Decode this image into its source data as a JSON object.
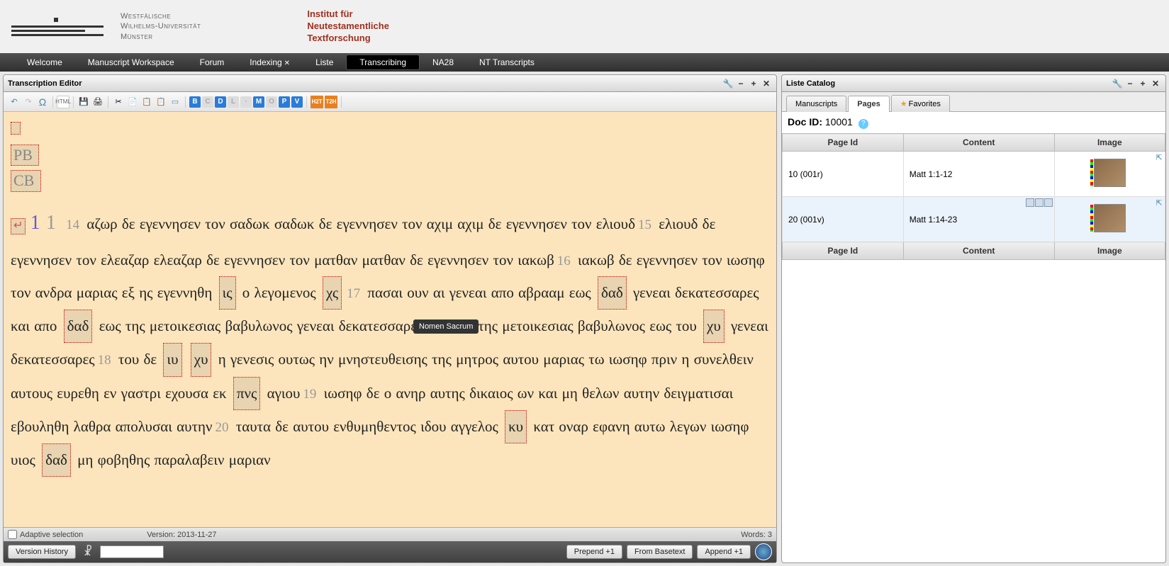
{
  "header": {
    "uni_line1": "Westfälische",
    "uni_line2": "Wilhelms-Universität",
    "uni_line3": "Münster",
    "inst_line1": "Institut für",
    "inst_line2": "Neutestamentliche",
    "inst_line3": "Textforschung"
  },
  "nav": {
    "welcome": "Welcome",
    "workspace": "Manuscript Workspace",
    "forum": "Forum",
    "indexing": "Indexing",
    "liste": "Liste",
    "transcribing": "Transcribing",
    "na28": "NA28",
    "nttranscripts": "NT Transcripts"
  },
  "left_panel": {
    "title": "Transcription Editor",
    "toolbar": {
      "undo": "↶",
      "redo": "↷",
      "omega": "Ω",
      "html": "HTML",
      "save": "💾",
      "print": "🖨",
      "cut": "✂",
      "copy": "📄",
      "paste": "📋",
      "paste2": "📋",
      "window": "▭",
      "B": "B",
      "C": "C",
      "D": "D",
      "L": "L",
      "M": "M",
      "O": "O",
      "P": "P",
      "V": "V",
      "h2t": "H2T",
      "t2h": "T2H"
    },
    "top_marker": "",
    "pb": "PB",
    "cb": "CB",
    "chapter": "1",
    "verse_big": "1",
    "verses": {
      "v14": "14",
      "v15": "15",
      "v16": "16",
      "v17": "17",
      "v18": "18",
      "v19": "19",
      "v20": "20"
    },
    "text": {
      "t14a": " αζωρ δε εγεννησεν τον σαδωκ σαδωκ δε εγεννησεν τον αχιμ αχιμ δε εγεννησεν τον ελιουδ",
      "t15a": " ελιουδ δε εγεννησεν τον ελεαζαρ ελεαζαρ δε εγεννησεν τον ματθαν ματθαν δε εγεννησεν τον ιακωβ",
      "t16a": " ιακωβ δε εγεννησεν τον ιωσηφ τον ανδρα μαριας εξ ης εγεννηθη ",
      "ns_is": "ις",
      "t16b": " ο λεγομενος ",
      "ns_xs": "χς",
      "t17a": " πασαι ουν αι γενεαι απο αβρααμ εως ",
      "ns_dad1": "δαδ",
      "t17b": " γενεαι δεκατεσσαρες και απο ",
      "ns_dad2": "δαδ",
      "t17c": " εως της μετοικεσιας βαβυλωνος γενεαι δεκατεσσαρες και απο της μετοικεσιας βαβυλωνος εως του ",
      "ns_xu1": "χυ",
      "t17d": " γενεαι δεκατεσσαρες",
      "t18a": " του δε ",
      "ns_iu": "ιυ",
      "ns_xu2": "χυ",
      "t18b": " η γενεσις ουτως ην μνηστευθεισης της μητρος αυτου μαριας τω ιωσηφ πριν η συνελθειν αυτους ευρεθη εν γαστρι εχουσα εκ ",
      "ns_pns": "πνς",
      "t18c": " αγιου",
      "t19a": " ιωσηφ δε ο ανηρ αυτης δικαιος ων και μη θελων αυτην δειγματισαι εβουληθη λαθρα απολυσαι αυτην",
      "t20a": " ταυτα δε αυτου ενθυμηθεντος ιδου αγγελος ",
      "ns_ku": "κυ",
      "t20b": " κατ οναρ εφανη αυτω λεγων ιωσηφ υιος ",
      "ns_dad3": "δαδ",
      "t20c": " μη φοβηθης παραλαβειν μαριαν"
    },
    "tooltip": "Nomen Sacrum",
    "status": {
      "adaptive": "Adaptive selection",
      "version": "Version: 2013-11-27",
      "words": "Words: 3"
    },
    "footer": {
      "history": "Version History",
      "prepend": "Prepend +1",
      "basetext": "From Basetext",
      "append": "Append +1"
    }
  },
  "right_panel": {
    "title": "Liste Catalog",
    "tabs": {
      "manuscripts": "Manuscripts",
      "pages": "Pages",
      "favorites": "Favorites"
    },
    "docid_label": "Doc ID:",
    "docid_value": "10001",
    "cols": {
      "pageid": "Page Id",
      "content": "Content",
      "image": "Image"
    },
    "rows": [
      {
        "pageid": "10 (001r)",
        "content": "Matt 1:1-12"
      },
      {
        "pageid": "20 (001v)",
        "content": "Matt 1:14-23"
      }
    ]
  }
}
